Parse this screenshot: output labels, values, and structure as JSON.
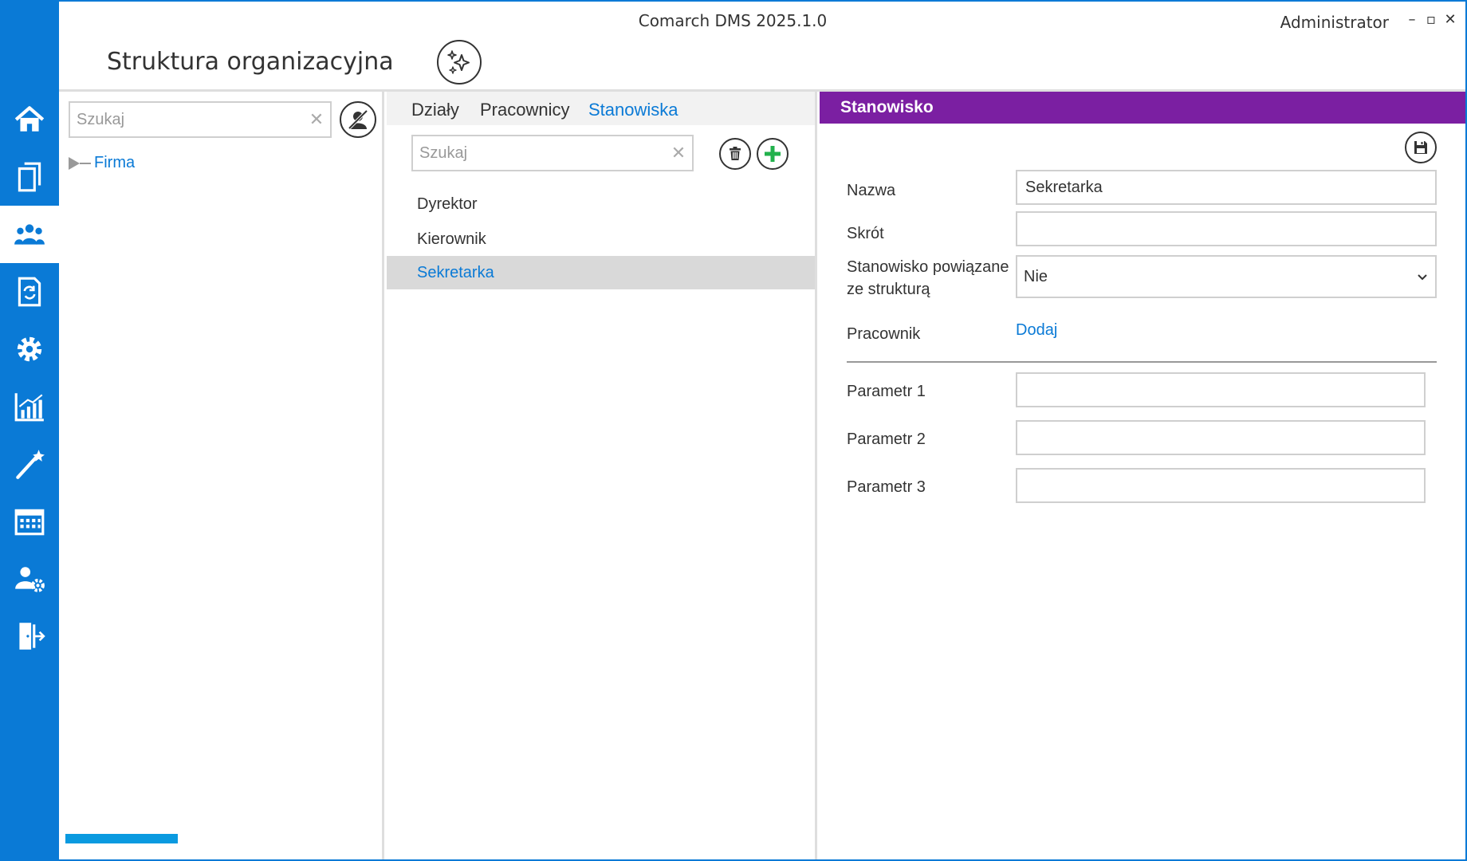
{
  "window": {
    "app_title": "Comarch DMS 2025.1.0",
    "user": "Administrator",
    "controls": {
      "minimize": "–",
      "maximize": "▫",
      "close": "✕"
    }
  },
  "page": {
    "title": "Struktura organizacyjna"
  },
  "sidebar": {
    "accent": "#0a7ad6",
    "items": [
      {
        "icon": "home-icon"
      },
      {
        "icon": "documents-icon"
      },
      {
        "icon": "users-icon",
        "active": true
      },
      {
        "icon": "document-cycle-icon"
      },
      {
        "icon": "gear-icon"
      },
      {
        "icon": "chart-icon"
      },
      {
        "icon": "magic-wand-icon"
      },
      {
        "icon": "calendar-icon"
      },
      {
        "icon": "user-settings-icon"
      },
      {
        "icon": "logout-icon"
      }
    ]
  },
  "left_panel": {
    "search_placeholder": "Szukaj",
    "clear": "✕",
    "tree": [
      {
        "label": "Firma"
      }
    ],
    "progress": 0.64
  },
  "middle_panel": {
    "tabs": [
      {
        "label": "Działy"
      },
      {
        "label": "Pracownicy"
      },
      {
        "label": "Stanowiska",
        "active": true
      }
    ],
    "search_placeholder": "Szukaj",
    "clear": "✕",
    "items": [
      {
        "label": "Dyrektor"
      },
      {
        "label": "Kierownik"
      },
      {
        "label": "Sekretarka",
        "selected": true
      }
    ]
  },
  "right_panel": {
    "header": "Stanowisko",
    "header_color": "#7b1fa2",
    "fields": {
      "name_label": "Nazwa",
      "name_value": "Sekretarka",
      "short_label": "Skrót",
      "short_value": "",
      "linked_label_1": "Stanowisko powiązane",
      "linked_label_2": "ze strukturą",
      "linked_value": "Nie",
      "employee_label": "Pracownik",
      "employee_link": "Dodaj",
      "param1_label": "Parametr 1",
      "param2_label": "Parametr 2",
      "param3_label": "Parametr 3"
    }
  }
}
